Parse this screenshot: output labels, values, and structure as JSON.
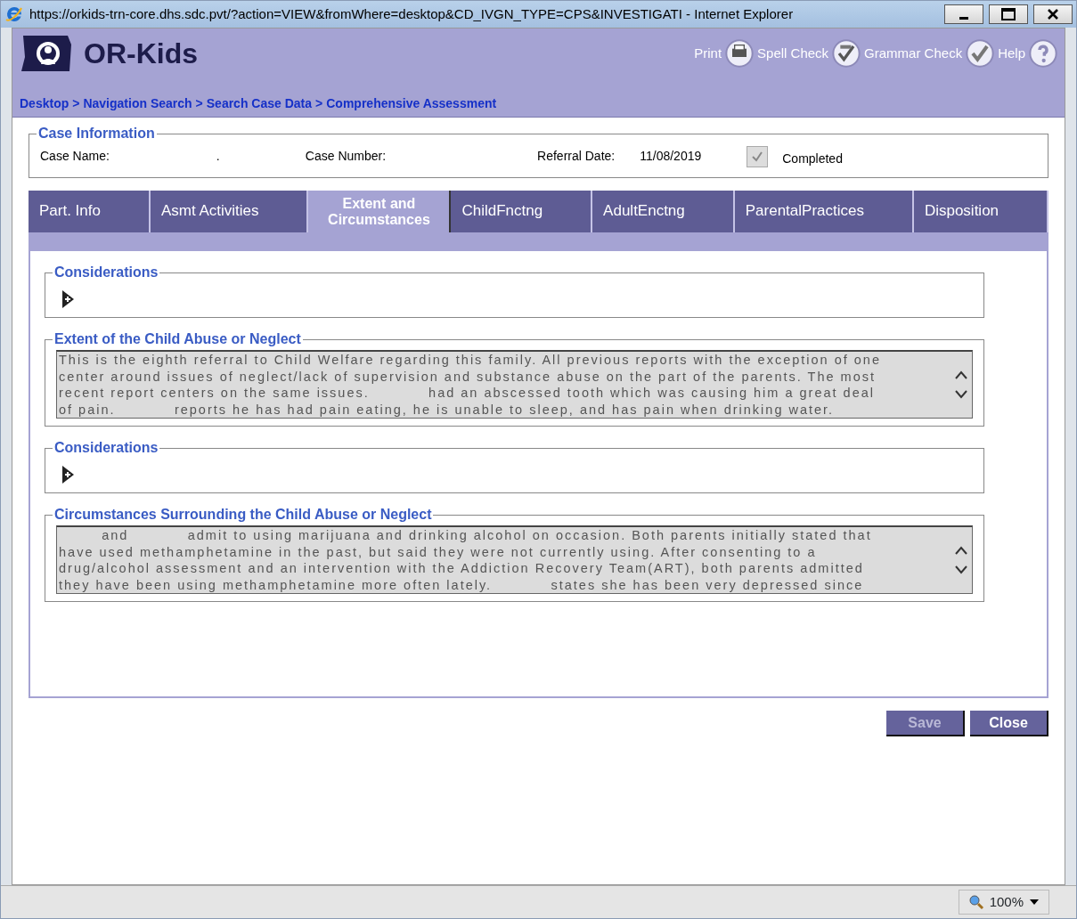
{
  "window": {
    "title": "https://orkids-trn-core.dhs.sdc.pvt/?action=VIEW&fromWhere=desktop&CD_IVGN_TYPE=CPS&INVESTIGATI - Internet Explorer"
  },
  "header": {
    "app_name": "OR-Kids",
    "tools": [
      {
        "label": "Print",
        "kind": "print"
      },
      {
        "label": "Spell Check",
        "kind": "spell"
      },
      {
        "label": "Grammar Check",
        "kind": "grammar"
      },
      {
        "label": "Help",
        "kind": "help"
      }
    ],
    "breadcrumb": {
      "separator": ">",
      "items": [
        "Desktop",
        "Navigation Search",
        "Search Case Data",
        "Comprehensive Assessment"
      ]
    }
  },
  "case_information": {
    "legend": "Case Information",
    "fields": [
      {
        "label": "Case Name:",
        "value": "."
      },
      {
        "label": "Case Number:"
      },
      {
        "label": "Referral Date:",
        "value": "11/08/2019"
      }
    ],
    "completed": {
      "label": "Completed",
      "checked": true
    }
  },
  "tabs": [
    {
      "label": "Part. Info",
      "selected": false
    },
    {
      "label": "Asmt Activities",
      "selected": false
    },
    {
      "label": "Extent and Circumstances",
      "selected": true
    },
    {
      "label": "ChildFnctng",
      "selected": false
    },
    {
      "label": "AdultEnctng",
      "selected": false
    },
    {
      "label": "ParentalPractices",
      "selected": false
    },
    {
      "label": "Disposition",
      "selected": false
    }
  ],
  "sections": [
    {
      "kind": "considerations",
      "legend": "Considerations",
      "expanded": false
    },
    {
      "kind": "narrative",
      "legend": "Extent of the Child Abuse or Neglect",
      "lines": [
        "This is the eighth referral to Child Welfare regarding this family. All previous reports with the exception of one",
        "center around issues of neglect/lack of supervision and substance abuse on the part of the parents. The most",
        "recent report centers on the same issues.           had an abscessed tooth which was causing him a great deal",
        "of pain.           reports he has had pain eating, he is unable to sleep, and has pain when drinking water."
      ]
    },
    {
      "kind": "considerations",
      "legend": "Considerations",
      "expanded": false
    },
    {
      "kind": "narrative",
      "legend": "Circumstances Surrounding the Child Abuse or Neglect",
      "lines": [
        "        and           admit to using marijuana and drinking alcohol on occasion. Both parents initially stated that",
        "have used methamphetamine in the past, but said they were not currently using. After consenting to a",
        "drug/alcohol assessment and an intervention with the Addiction Recovery Team(ART), both parents admitted",
        "they have been using methamphetamine more often lately.           states she has been very depressed since"
      ]
    }
  ],
  "buttons": [
    {
      "label": "Save",
      "disabled": true
    },
    {
      "label": "Close",
      "disabled": false
    }
  ],
  "status_bar": {
    "zoom": "100%"
  }
}
